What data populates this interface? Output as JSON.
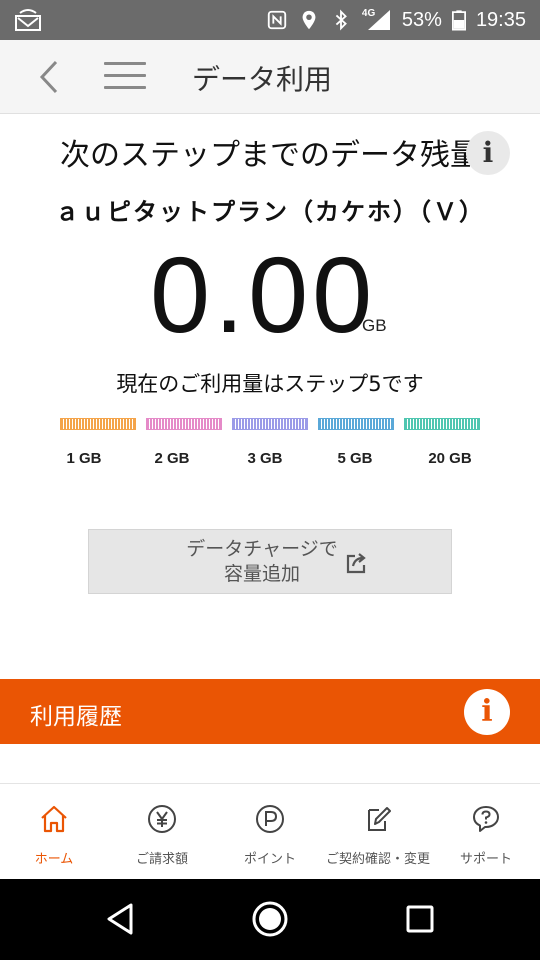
{
  "status_bar": {
    "battery_percent": "53%",
    "time": "19:35",
    "network": "4G"
  },
  "header": {
    "title": "データ利用"
  },
  "main": {
    "title": "次のステップまでのデータ残量",
    "plan_name": "ａｕピタットプラン（カケホ）（Ｖ）",
    "remaining_value": "0.00",
    "remaining_unit": "GB",
    "step_status": "現在のご利用量はステップ5です",
    "steps": [
      {
        "label": "1 GB",
        "color": "#f4a44a"
      },
      {
        "label": "2 GB",
        "color": "#e58ac8"
      },
      {
        "label": "3 GB",
        "color": "#9b9be8"
      },
      {
        "label": "5 GB",
        "color": "#5aa8d8"
      },
      {
        "label": "20 GB",
        "color": "#4fc6b0"
      }
    ],
    "charge_button": {
      "line1": "データチャージで",
      "line2": "容量追加"
    }
  },
  "history": {
    "title": "利用履歴",
    "info_label": "i"
  },
  "info_label": "i",
  "tabs": [
    {
      "label": "ホーム",
      "icon": "home-icon",
      "active": true
    },
    {
      "label": "ご請求額",
      "icon": "yen-icon",
      "active": false
    },
    {
      "label": "ポイント",
      "icon": "point-icon",
      "active": false
    },
    {
      "label": "ご契約確認・変更",
      "icon": "contract-edit-icon",
      "active": false
    },
    {
      "label": "サポート",
      "icon": "support-icon",
      "active": false
    }
  ],
  "colors": {
    "accent": "#ea5504",
    "header_bg": "#f5f5f5",
    "status_bar_bg": "#6b6b6b"
  }
}
